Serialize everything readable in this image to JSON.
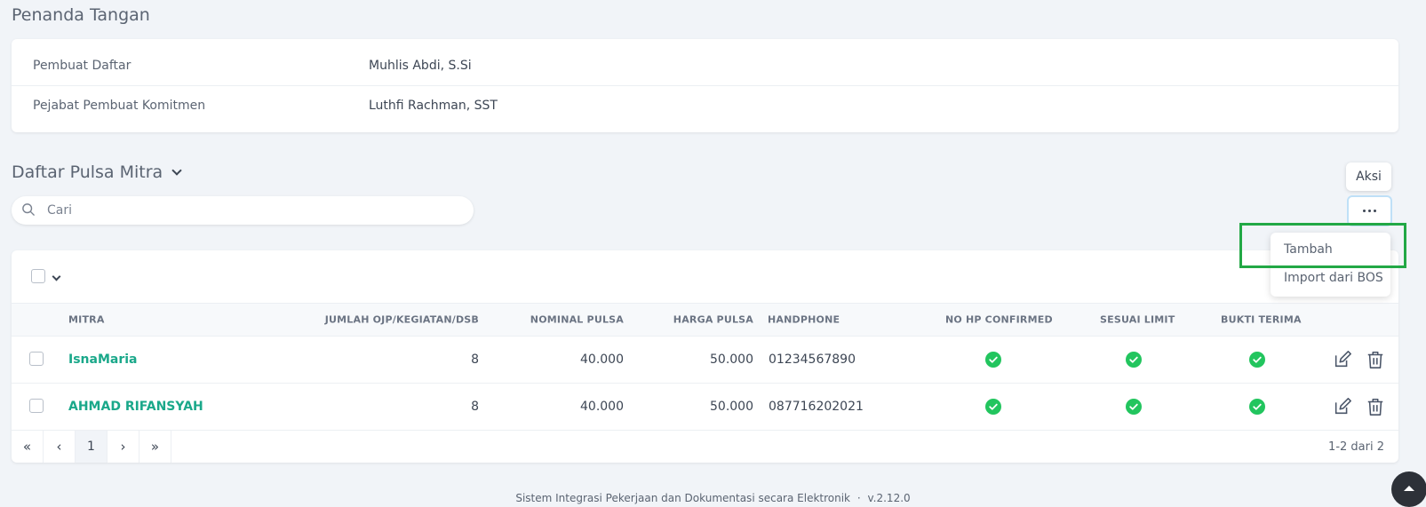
{
  "signature": {
    "title": "Penanda Tangan",
    "rows": [
      {
        "label": "Pembuat Daftar",
        "value": "Muhlis Abdi, S.Si"
      },
      {
        "label": "Pejabat Pembuat Komitmen",
        "value": "Luthfi Rachman, SST"
      }
    ]
  },
  "list": {
    "title": "Daftar Pulsa Mitra",
    "search_placeholder": "Cari",
    "aksi_label": "Aksi",
    "dropdown": [
      "Tambah",
      "Import dari BOS"
    ],
    "columns": [
      "MITRA",
      "JUMLAH OJP/KEGIATAN/DSB",
      "NOMINAL PULSA",
      "HARGA PULSA",
      "HANDPHONE",
      "NO HP CONFIRMED",
      "SESUAI LIMIT",
      "BUKTI TERIMA"
    ],
    "rows": [
      {
        "mitra": "IsnaMaria",
        "jumlah": "8",
        "nominal": "40.000",
        "harga": "50.000",
        "handphone": "01234567890",
        "confirmed": true,
        "limit": true,
        "bukti": true
      },
      {
        "mitra": "AHMAD RIFANSYAH",
        "jumlah": "8",
        "nominal": "40.000",
        "harga": "50.000",
        "handphone": "087716202021",
        "confirmed": true,
        "limit": true,
        "bukti": true
      }
    ],
    "pagination": {
      "first": "«",
      "prev": "‹",
      "page": "1",
      "next": "›",
      "last": "»",
      "range": "1-2 dari 2"
    }
  },
  "footer": {
    "text": "Sistem Integrasi Pekerjaan dan Dokumentasi secara Elektronik",
    "sep": "·",
    "version": "v.2.12.0"
  },
  "colors": {
    "accent": "#1aa88a",
    "check": "#22c55e",
    "highlight": "#22a845"
  },
  "icons": [
    "search-icon",
    "chevron-down-icon",
    "more-icon",
    "check-circle-icon",
    "edit-icon",
    "trash-icon",
    "arrow-up-icon"
  ]
}
